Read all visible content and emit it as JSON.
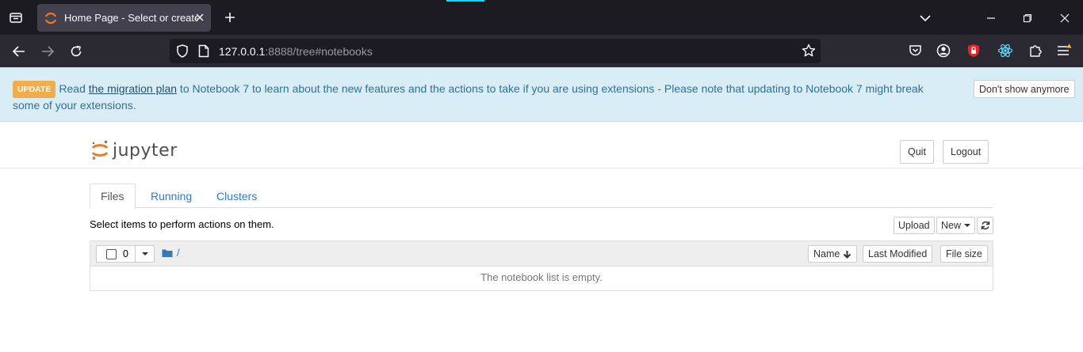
{
  "browser": {
    "tab": {
      "title": "Home Page - Select or create a notebook"
    },
    "url": {
      "host": "127.0.0.1",
      "rest": ":8888/tree#notebooks"
    },
    "icons": {
      "tab_list": "tab-list-icon",
      "new_tab": "plus-icon",
      "back": "arrow-left-icon",
      "forward": "arrow-right-icon",
      "reload": "reload-icon",
      "bookmark": "star-icon",
      "pocket": "pocket-icon",
      "account": "account-icon",
      "ublock": "ublock-icon",
      "react_devtools": "react-icon",
      "extensions": "puzzle-icon",
      "menu": "hamburger-menu-icon"
    }
  },
  "banner": {
    "badge": "UPDATE",
    "text_before": "Read ",
    "link": "the migration plan",
    "text_after": " to Notebook 7 to learn about the new features and the actions to take if you are using extensions - Please note that updating to Notebook 7 might break some of your extensions.",
    "dismiss": "Don't show anymore"
  },
  "header": {
    "logo_text": "jupyter",
    "quit": "Quit",
    "logout": "Logout"
  },
  "tabs": [
    "Files",
    "Running",
    "Clusters"
  ],
  "toolbar": {
    "hint": "Select items to perform actions on them.",
    "upload": "Upload",
    "new": "New"
  },
  "list": {
    "selected_count": "0",
    "path": "/",
    "columns": [
      "Name",
      "Last Modified",
      "File size"
    ],
    "empty_message": "The notebook list is empty."
  },
  "colors": {
    "tabbar": "#1c1b22",
    "navbar": "#2b2a33",
    "banner_bg": "#d9edf7",
    "banner_text": "#31708f",
    "badge": "#f0ad4e",
    "link": "#337ab7",
    "jupyter_orange": "#f37726"
  }
}
